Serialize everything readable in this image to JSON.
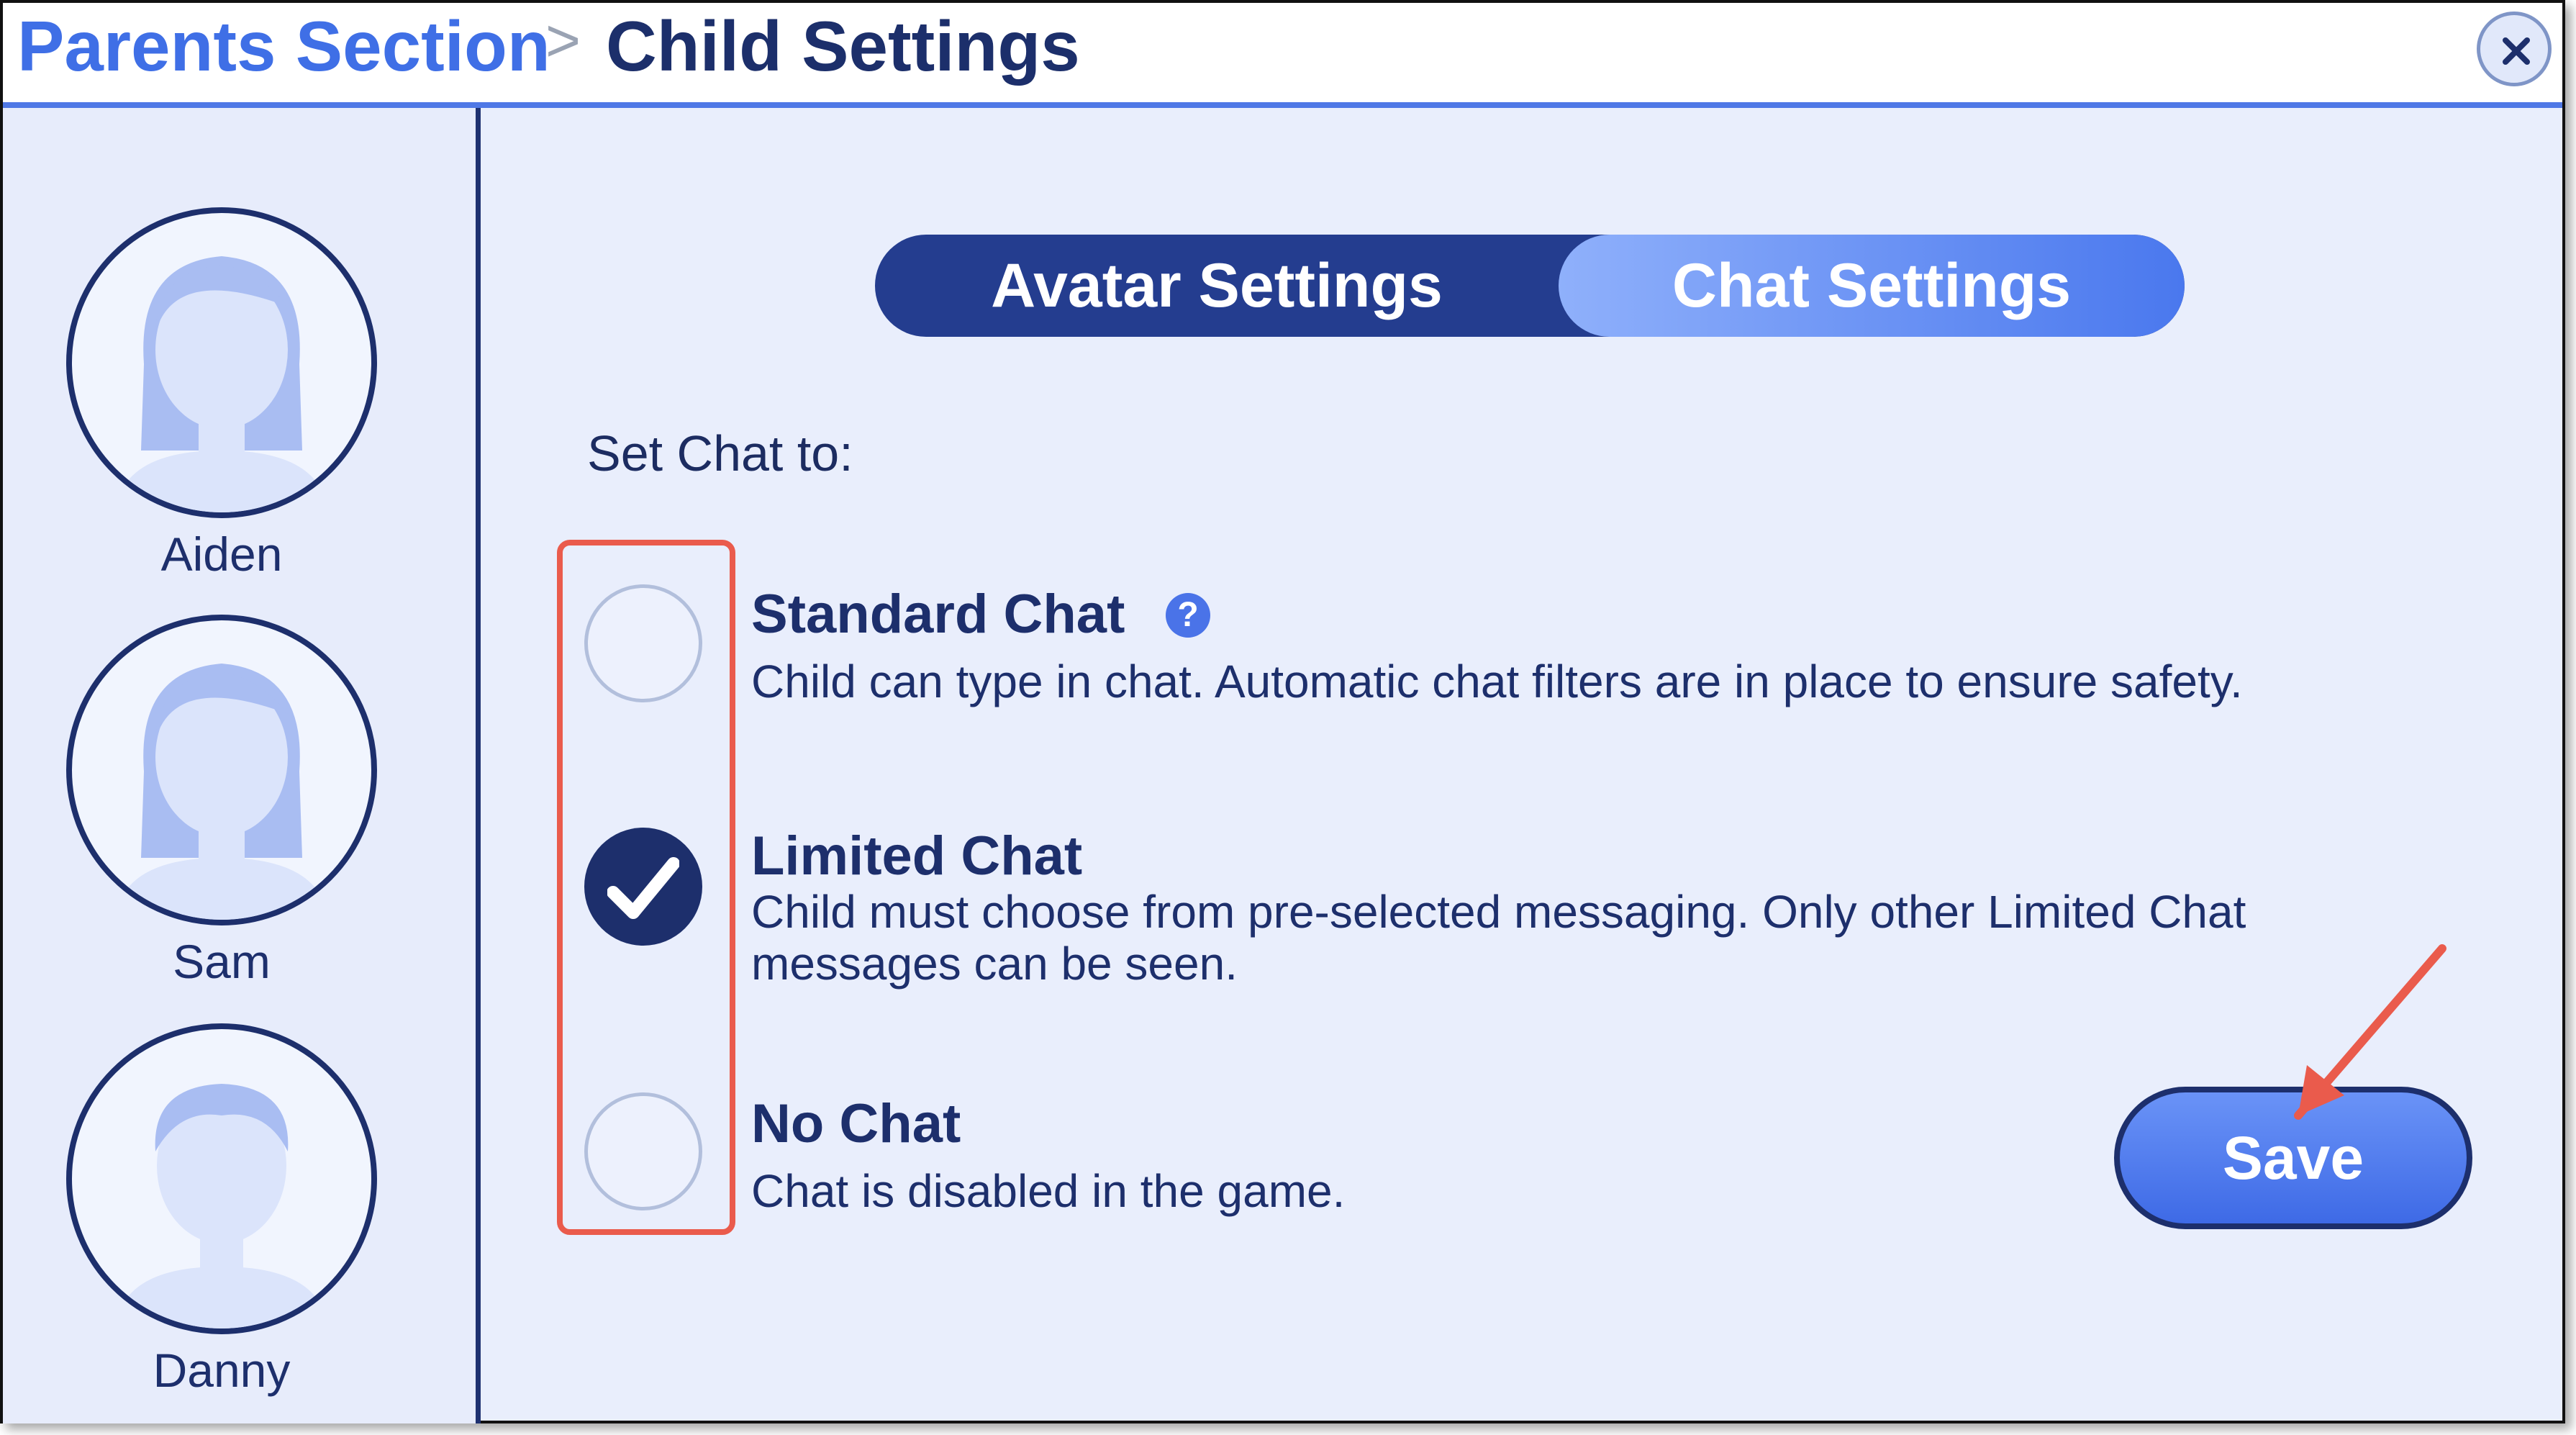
{
  "header": {
    "breadcrumb_parent": "Parents Section",
    "separator": ">",
    "current": "Child Settings",
    "close_icon": "close-icon"
  },
  "sidebar": {
    "children": [
      {
        "name": "Aiden",
        "avatar": "girl-long-hair-avatar"
      },
      {
        "name": "Sam",
        "avatar": "girl-long-hair-avatar"
      },
      {
        "name": "Danny",
        "avatar": "boy-short-hair-avatar"
      }
    ]
  },
  "tabs": {
    "avatar": "Avatar Settings",
    "chat": "Chat Settings",
    "selected": "Chat Settings"
  },
  "chat_settings": {
    "label": "Set Chat to:",
    "selected_option": "Limited Chat",
    "options": [
      {
        "title": "Standard Chat",
        "description": "Child can type in chat. Automatic chat filters are in place to ensure safety.",
        "help_icon": "?"
      },
      {
        "title": "Limited Chat",
        "description_line1": "Child must choose from pre-selected messaging. Only other Limited Chat",
        "description_line2": "messages can be seen."
      },
      {
        "title": "No Chat",
        "description": "Chat is disabled in the game."
      }
    ]
  },
  "save_label": "Save",
  "colors": {
    "accent": "#3f6fe6",
    "navy": "#1d2f6c",
    "background": "#e9eefc",
    "annotation": "#ea5b4c"
  }
}
